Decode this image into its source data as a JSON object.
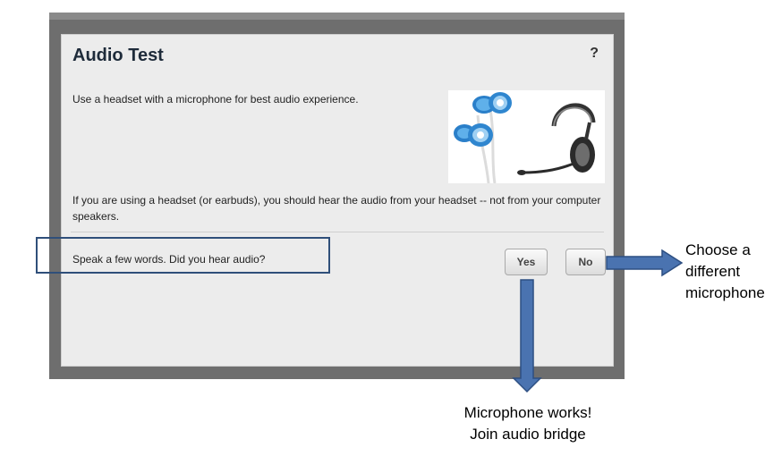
{
  "dialog": {
    "title": "Audio Test",
    "help_label": "?",
    "intro": "Use a headset with a microphone for best audio experience.",
    "info": "If you are using a headset (or earbuds), you should hear the audio from your headset -- not from your computer speakers.",
    "prompt": "Speak a few words.  Did you hear audio?",
    "yes_label": "Yes",
    "no_label": "No"
  },
  "annotations": {
    "no_outcome_lines": [
      "Choose a",
      "different",
      "microphone"
    ],
    "yes_outcome_lines": [
      "Microphone works!",
      "Join audio bridge"
    ]
  },
  "colors": {
    "arrow_fill": "#4a73b0",
    "arrow_stroke": "#2d4f82",
    "highlight_border": "#2f4f7a",
    "dialog_bg": "#ececec",
    "backdrop": "#6e6e6e"
  }
}
